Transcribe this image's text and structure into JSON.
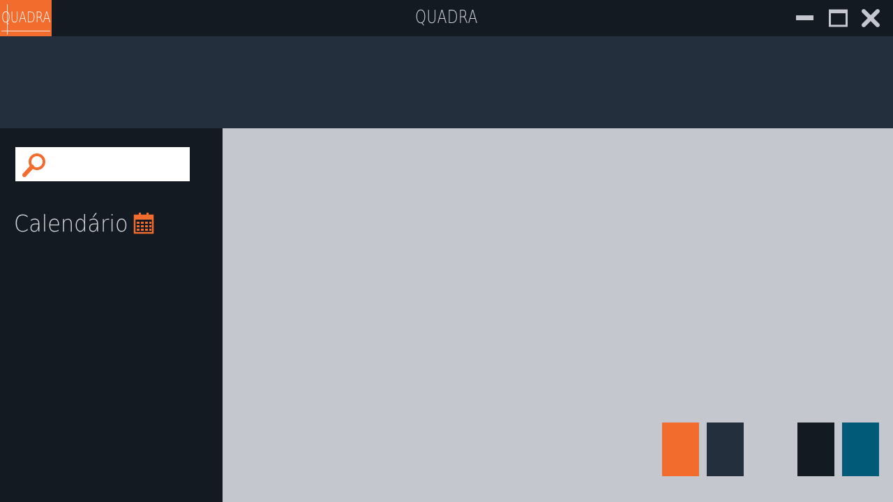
{
  "app": {
    "logo_text": "QUADRA",
    "title": "QUADRA"
  },
  "window_controls": {
    "minimize_icon": "minimize-icon",
    "maximize_icon": "maximize-icon",
    "close_icon": "close-icon"
  },
  "sidebar": {
    "search": {
      "value": "",
      "placeholder": "",
      "icon": "search-icon"
    },
    "items": [
      {
        "label": "Calendário",
        "icon": "calendar-icon"
      }
    ]
  },
  "palette": {
    "swatches": [
      {
        "name": "orange",
        "color": "#f26c2e"
      },
      {
        "name": "slate",
        "color": "#232f3c"
      },
      {
        "name": "ink",
        "color": "#141a21"
      },
      {
        "name": "teal",
        "color": "#005a78"
      }
    ]
  },
  "colors": {
    "accent": "#f26c2e",
    "titlebar": "#141a21",
    "header": "#232f3c",
    "sidebar": "#141a21",
    "content": "#c5c7cf"
  }
}
